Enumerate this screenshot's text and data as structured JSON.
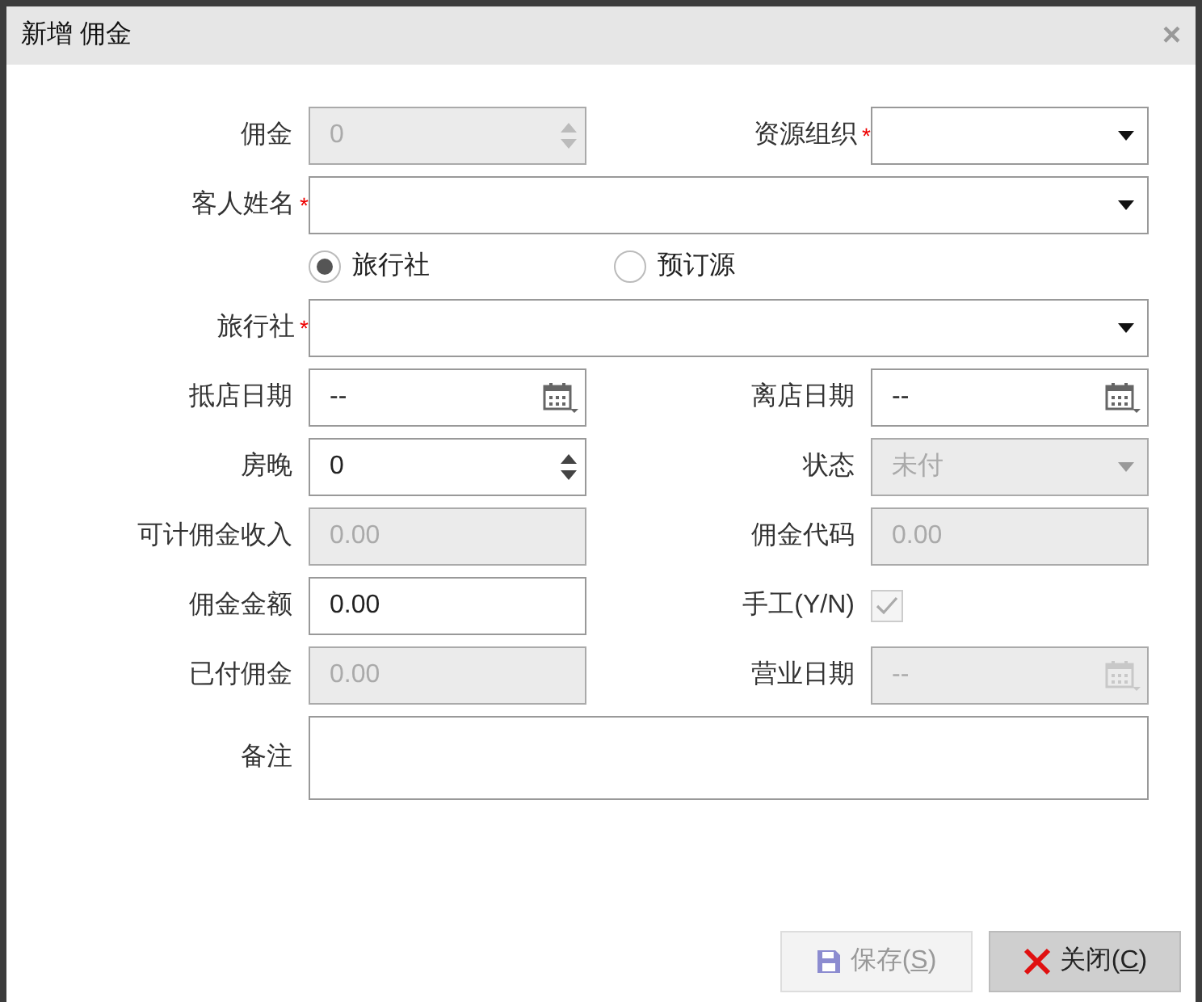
{
  "window": {
    "title": "新增 佣金",
    "close": "×"
  },
  "rows": [
    [
      {
        "label": "佣金",
        "kind": "spinner",
        "value": "0",
        "disabled": true
      },
      {
        "label": "资源组织",
        "required_mark": "*",
        "kind": "select",
        "disabled": false
      }
    ],
    [
      {
        "label": "客人姓名",
        "required_mark": "*",
        "kind": "select",
        "disabled": false
      }
    ],
    [
      {
        "kind": "radio_group",
        "options": [
          {
            "label": "旅行社",
            "selected": true
          },
          {
            "label": "预订源",
            "selected": false
          }
        ]
      }
    ],
    [
      {
        "label": "旅行社",
        "required_mark": "*",
        "kind": "select",
        "disabled": false
      }
    ],
    [
      {
        "label": "抵店日期",
        "kind": "date",
        "value": "--",
        "disabled": false
      },
      {
        "label": "离店日期",
        "kind": "date",
        "value": "--",
        "disabled": false
      }
    ],
    [
      {
        "label": "房晚",
        "kind": "spinner",
        "value": "0",
        "disabled": false
      },
      {
        "label": "状态",
        "kind": "select",
        "value": "未付",
        "disabled": true
      }
    ],
    [
      {
        "label": "可计佣金收入",
        "kind": "text",
        "value": "0.00",
        "disabled": true
      },
      {
        "label": "佣金代码",
        "kind": "text",
        "value": "0.00",
        "disabled": true
      }
    ],
    [
      {
        "label": "佣金金额",
        "kind": "text",
        "value": "0.00",
        "disabled": false
      },
      {
        "label": "手工(Y/N)",
        "kind": "checkbox",
        "checked": true,
        "disabled": true
      }
    ],
    [
      {
        "label": "已付佣金",
        "kind": "text",
        "value": "0.00",
        "disabled": true
      },
      {
        "label": "营业日期",
        "kind": "date",
        "value": "--",
        "disabled": true
      }
    ],
    [
      {
        "label": "备注",
        "kind": "textarea",
        "disabled": false
      }
    ]
  ],
  "buttons": [
    {
      "kind": "save",
      "before": "保存(",
      "key": "S",
      "after": ")",
      "disabled": true
    },
    {
      "kind": "close",
      "before": "关闭(",
      "key": "C",
      "after": ")",
      "disabled": false
    }
  ]
}
